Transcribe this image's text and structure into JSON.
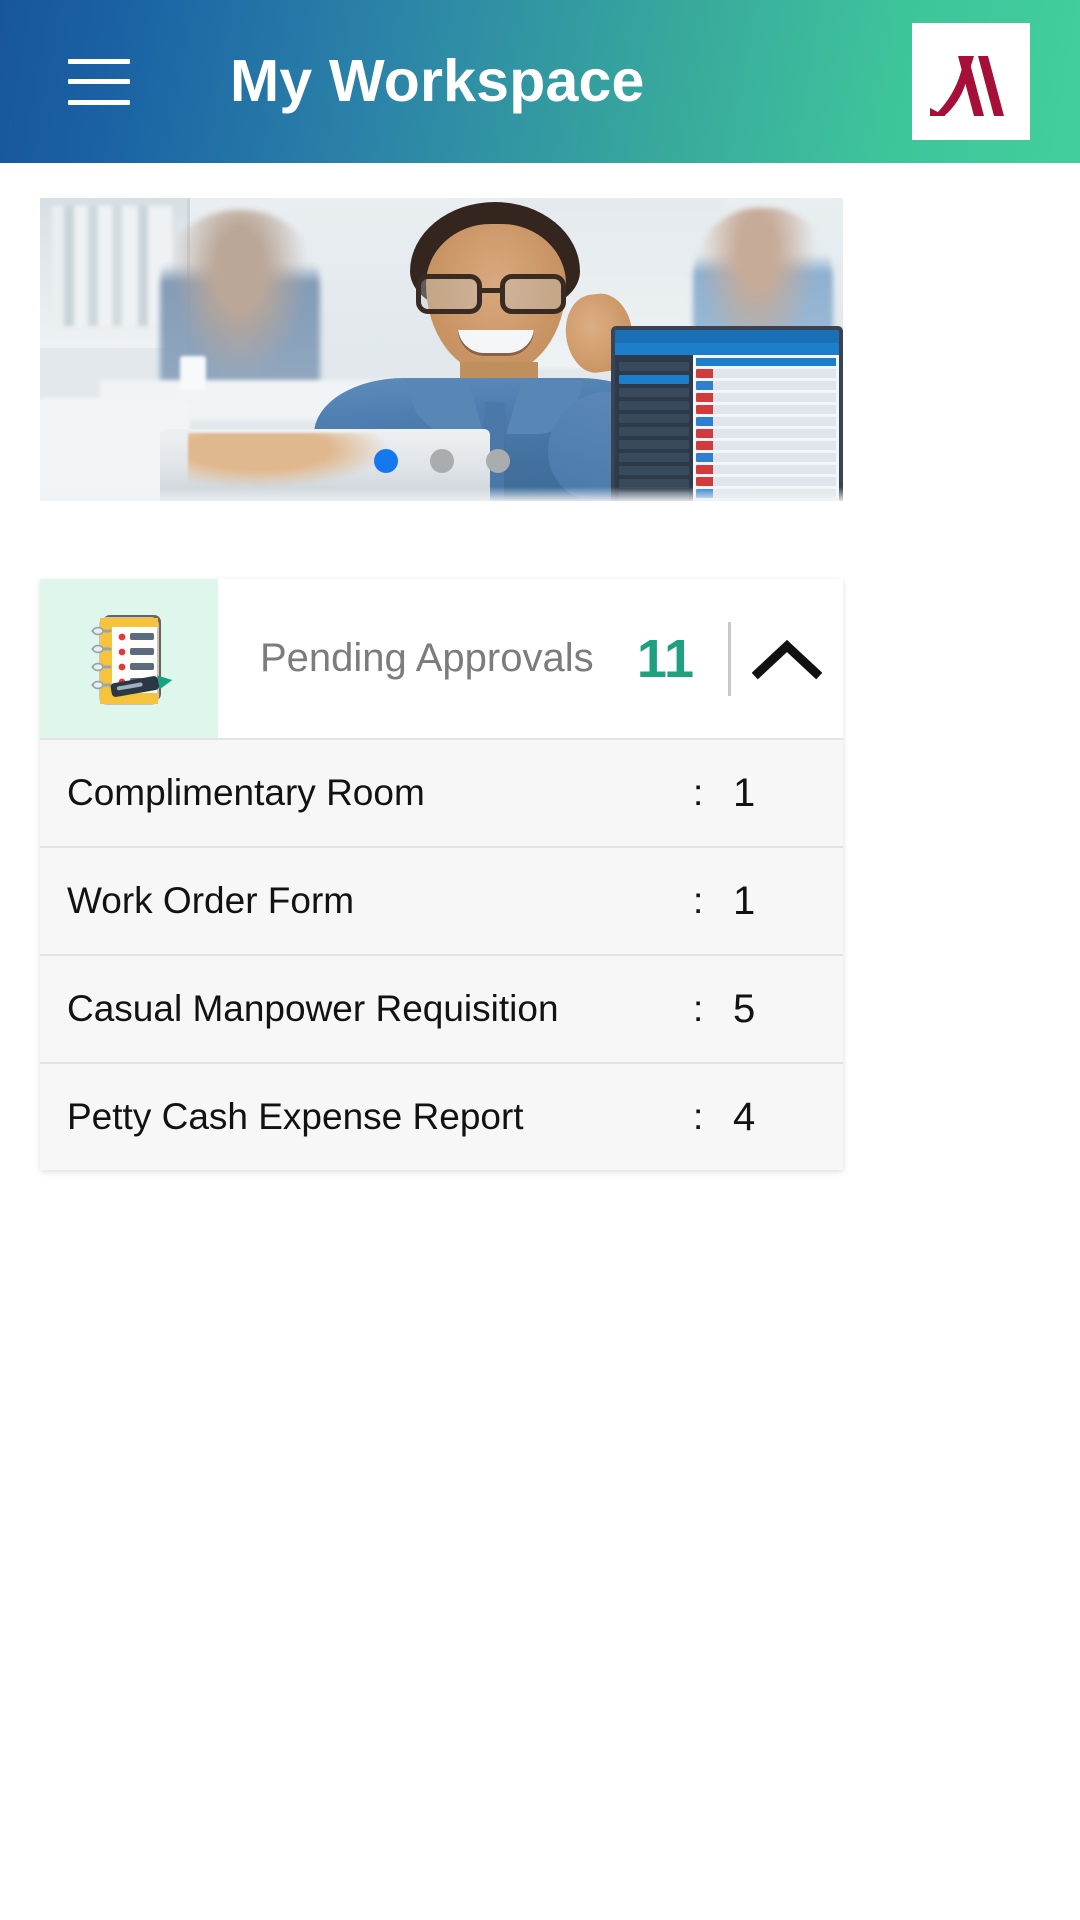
{
  "header": {
    "title": "My Workspace",
    "menu_icon": "hamburger-menu-icon",
    "brand_logo": "marriott-m-logo",
    "gradient_start": "#18569b",
    "gradient_end": "#42cf9d"
  },
  "carousel": {
    "slide_alt": "office-team-banner",
    "active_index": 0,
    "dots": [
      {
        "active": true,
        "color": "#1578ef"
      },
      {
        "active": false,
        "color": "#a9adb0"
      },
      {
        "active": false,
        "color": "#a9adb0"
      }
    ]
  },
  "approvals_card": {
    "icon": "checklist-pencil-icon",
    "icon_background": "#dff6ec",
    "title": "Pending Approvals",
    "count": "11",
    "count_color": "#1fa07e",
    "toggle_icon": "chevron-up-icon",
    "expanded": true,
    "separator": ":",
    "rows": [
      {
        "label": "Complimentary Room",
        "value": "1"
      },
      {
        "label": "Work Order Form",
        "value": "1"
      },
      {
        "label": "Casual Manpower Requisition",
        "value": "5"
      },
      {
        "label": "Petty Cash Expense Report",
        "value": "4"
      }
    ]
  }
}
